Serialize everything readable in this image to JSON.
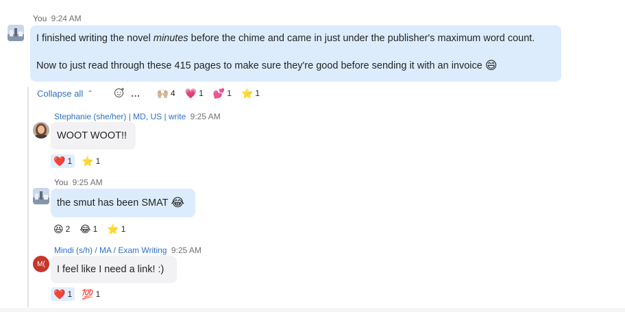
{
  "messages": {
    "first": {
      "author": "You",
      "time": "9:24 AM",
      "line1_before": "I finished writing the novel ",
      "line1_italic": "minutes",
      "line1_after": " before the chime and came in just under the publisher's maximum word count.",
      "line2": "Now to just read through these 415 pages to make sure they're good before sending it with an invoice",
      "line2_emoji": "😄"
    },
    "first_toolbar": {
      "collapse_label": "Collapse all",
      "collapse_icon": "chevron-up",
      "add_reaction_icon": "add-reaction",
      "more_icon": "…",
      "reactions": [
        {
          "emoji": "🙌🏼",
          "count": "4"
        },
        {
          "emoji": "💗",
          "count": "1"
        },
        {
          "emoji": "💕",
          "count": "1"
        },
        {
          "emoji": "⭐",
          "count": "1"
        }
      ]
    },
    "reply1": {
      "author": "Stephanie (she/her) | MD, US | write",
      "time": "9:25 AM",
      "text": "WOOT WOOT!!",
      "reactions": [
        {
          "emoji": "❤️",
          "count": "1"
        },
        {
          "emoji": "⭐",
          "count": "1"
        }
      ]
    },
    "reply2": {
      "author": "You",
      "time": "9:25 AM",
      "text": "the smut has been SMAT",
      "emoji": "😂",
      "reactions": [
        {
          "emoji": "😆",
          "count": "2"
        },
        {
          "emoji": "😂",
          "count": "1"
        },
        {
          "emoji": "⭐",
          "count": "1"
        }
      ]
    },
    "reply3": {
      "author": "Mindi (s/h) / MA / Exam Writing",
      "time": "9:25 AM",
      "avatar_initials": "M(",
      "text": "I feel like I need a link! :)",
      "reactions": [
        {
          "emoji": "❤️",
          "count": "1"
        },
        {
          "emoji": "💯",
          "count": "1"
        }
      ]
    }
  },
  "colors": {
    "my_bubble": "#dcecfd",
    "their_bubble": "#f2f2f4",
    "link": "#2f6fbf",
    "selected_reaction": "#e2edfb",
    "mindi_avatar": "#c4372d"
  }
}
